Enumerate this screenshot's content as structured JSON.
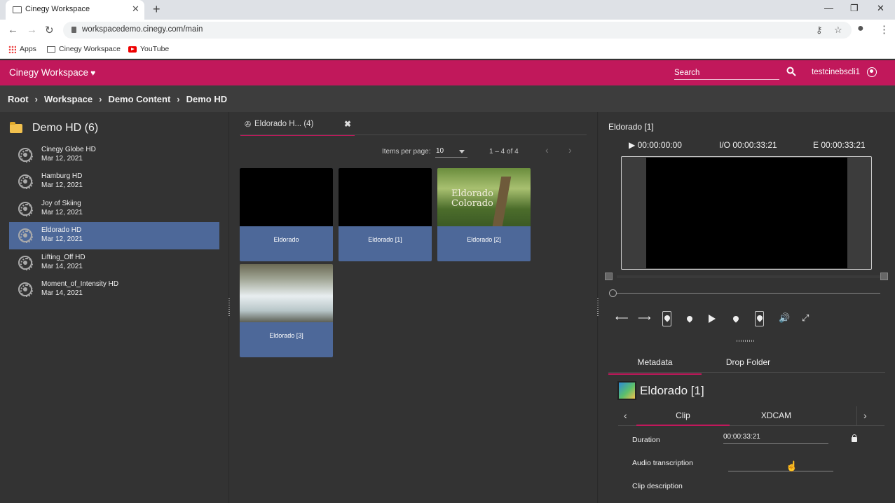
{
  "browser": {
    "tab_title": "Cinegy Workspace",
    "url": "workspacedemo.cinegy.com/main",
    "bookmarks": [
      "Apps",
      "Cinegy Workspace",
      "YouTube"
    ]
  },
  "app": {
    "title": "Cinegy Workspace",
    "search_placeholder": "Search",
    "user": "testcinebscli1",
    "brand_color": "#c1185b"
  },
  "breadcrumb": [
    "Root",
    "Workspace",
    "Demo Content",
    "Demo HD"
  ],
  "tree": {
    "title": "Demo HD (6)",
    "items": [
      {
        "name": "Cinegy Globe HD",
        "date": "Mar 12, 2021",
        "selected": false
      },
      {
        "name": "Hamburg HD",
        "date": "Mar 12, 2021",
        "selected": false
      },
      {
        "name": "Joy of Skiing",
        "date": "Mar 12, 2021",
        "selected": false
      },
      {
        "name": "Eldorado HD",
        "date": "Mar 12, 2021",
        "selected": true
      },
      {
        "name": "Lifting_Off HD",
        "date": "Mar 14, 2021",
        "selected": false
      },
      {
        "name": "Moment_of_Intensity HD",
        "date": "Mar 14, 2021",
        "selected": false
      }
    ]
  },
  "bin": {
    "tab_label": "Eldorado H... (4)",
    "items_per_page_label": "Items per page:",
    "items_per_page": "10",
    "range": "1 – 4 of 4",
    "cards": [
      {
        "label": "Eldorado",
        "thumb": "black"
      },
      {
        "label": "Eldorado [1]",
        "thumb": "black"
      },
      {
        "label": "Eldorado [2]",
        "thumb": "forest",
        "overlay": "Eldorado\nColorado"
      },
      {
        "label": "Eldorado [3]",
        "thumb": "river"
      }
    ]
  },
  "player": {
    "clip_title": "Eldorado [1]",
    "position": "00:00:00:00",
    "io": "I/O 00:00:33:21",
    "end": "E 00:00:33:21"
  },
  "meta": {
    "tabs": [
      "Metadata",
      "Drop Folder"
    ],
    "asset_title": "Eldorado [1]",
    "sub_tabs": [
      "Clip",
      "XDCAM"
    ],
    "fields": [
      {
        "label": "Duration",
        "value": "00:00:33:21"
      },
      {
        "label": "Audio transcription",
        "value": ""
      },
      {
        "label": "Clip description",
        "value": ""
      }
    ]
  }
}
